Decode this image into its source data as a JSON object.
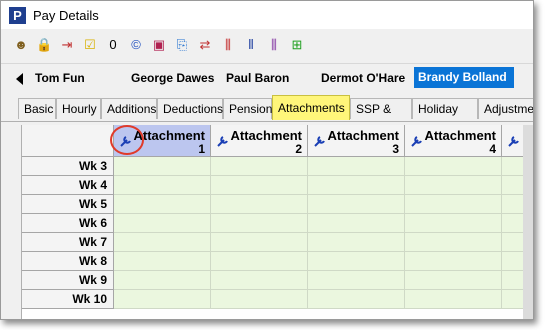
{
  "window": {
    "title": "Pay Details",
    "app_icon_letter": "P"
  },
  "toolbar": {
    "icons": [
      {
        "name": "person-icon",
        "glyph": "☻",
        "color": "#806020"
      },
      {
        "name": "lock-icon",
        "glyph": "🔒",
        "color": "#c8a000"
      },
      {
        "name": "import-icon",
        "glyph": "⇥",
        "color": "#c03030"
      },
      {
        "name": "checklist-icon",
        "glyph": "☑",
        "color": "#d8b000"
      },
      {
        "name": "zero-icon",
        "glyph": "0",
        "color": "#000000"
      },
      {
        "name": "copyright-icon",
        "glyph": "©",
        "color": "#2050c0"
      },
      {
        "name": "book-icon",
        "glyph": "▣",
        "color": "#b02050"
      },
      {
        "name": "copy-icon",
        "glyph": "⎘",
        "color": "#2070d0"
      },
      {
        "name": "transfer-icon",
        "glyph": "⇄",
        "color": "#c03030"
      },
      {
        "name": "column-insert-icon",
        "glyph": "⫼",
        "color": "#c02020"
      },
      {
        "name": "columns-icon",
        "glyph": "⦀",
        "color": "#2040a0"
      },
      {
        "name": "column-delete-icon",
        "glyph": "⫼",
        "color": "#8030a0"
      },
      {
        "name": "add-column-icon",
        "glyph": "⊞",
        "color": "#20a020"
      }
    ]
  },
  "employees": {
    "items": [
      {
        "label": "Tom Fun"
      },
      {
        "label": "George Dawes"
      },
      {
        "label": "Paul Baron"
      },
      {
        "label": "Dermot O'Hare"
      },
      {
        "label": "Brandy Bolland"
      }
    ]
  },
  "tabs": [
    {
      "label": "Basic"
    },
    {
      "label": "Hourly"
    },
    {
      "label": "Additions"
    },
    {
      "label": "Deductions"
    },
    {
      "label": "Pensions"
    },
    {
      "label": "Attachments"
    },
    {
      "label": "SSP & SMP"
    },
    {
      "label": "Holiday Pay"
    },
    {
      "label": "Adjustme"
    }
  ],
  "grid": {
    "columns": [
      {
        "title": "Attachment",
        "number": "1"
      },
      {
        "title": "Attachment",
        "number": "2"
      },
      {
        "title": "Attachment",
        "number": "3"
      },
      {
        "title": "Attachment",
        "number": "4"
      },
      {
        "title": "A",
        "number": ""
      }
    ],
    "rows": [
      {
        "label": "Wk 3"
      },
      {
        "label": "Wk 4"
      },
      {
        "label": "Wk 5"
      },
      {
        "label": "Wk 6"
      },
      {
        "label": "Wk 7"
      },
      {
        "label": "Wk 8"
      },
      {
        "label": "Wk 9"
      },
      {
        "label": "Wk 10"
      }
    ]
  },
  "colors": {
    "selected_employee": "#0a74d6",
    "active_tab": "#fff67a",
    "cell": "#ebf7df",
    "highlight_circle": "#e03a2a"
  }
}
